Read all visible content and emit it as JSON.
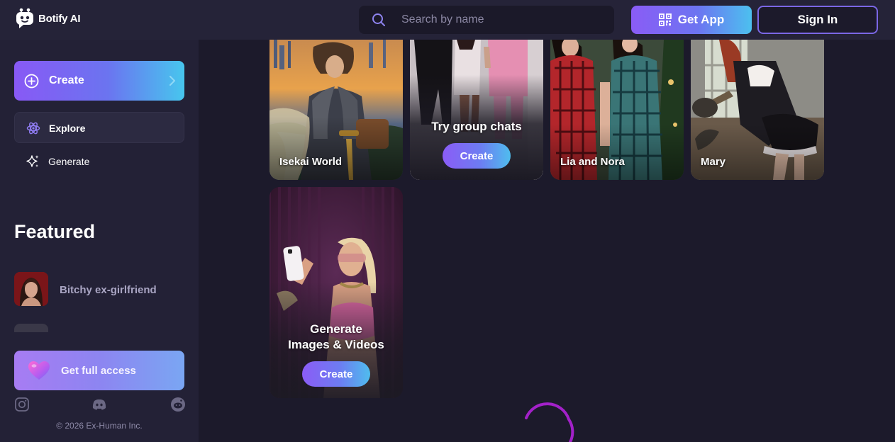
{
  "brand": {
    "name": "Botify AI"
  },
  "search": {
    "placeholder": "Search by name"
  },
  "header": {
    "get_app_label": "Get App",
    "sign_in_label": "Sign In"
  },
  "sidebar": {
    "create_label": "Create",
    "nav": [
      {
        "label": "Explore",
        "icon": "atom-icon",
        "active": true
      },
      {
        "label": "Generate",
        "icon": "sparkle-icon",
        "active": false
      }
    ],
    "featured_title": "Featured",
    "featured": [
      {
        "label": "Bitchy ex-girlfriend"
      }
    ],
    "full_access_label": "Get full access",
    "social": [
      "instagram-icon",
      "discord-icon",
      "reddit-icon"
    ],
    "copyright": "© 2026 Ex-Human Inc."
  },
  "cards": [
    {
      "label": "Isekai World"
    },
    {
      "title": "Try group chats",
      "button": "Create"
    },
    {
      "label": "Lia and Nora"
    },
    {
      "label": "Mary"
    },
    {
      "title_line1": "Generate",
      "title_line2": "Images & Videos",
      "button": "Create"
    }
  ],
  "colors": {
    "background": "#1c1a2b",
    "topbar": "#252338",
    "sidebar": "#232136",
    "accent_purple": "#8a5cf6",
    "accent_cyan": "#4cc0ef",
    "spinner": "#a321c9"
  }
}
